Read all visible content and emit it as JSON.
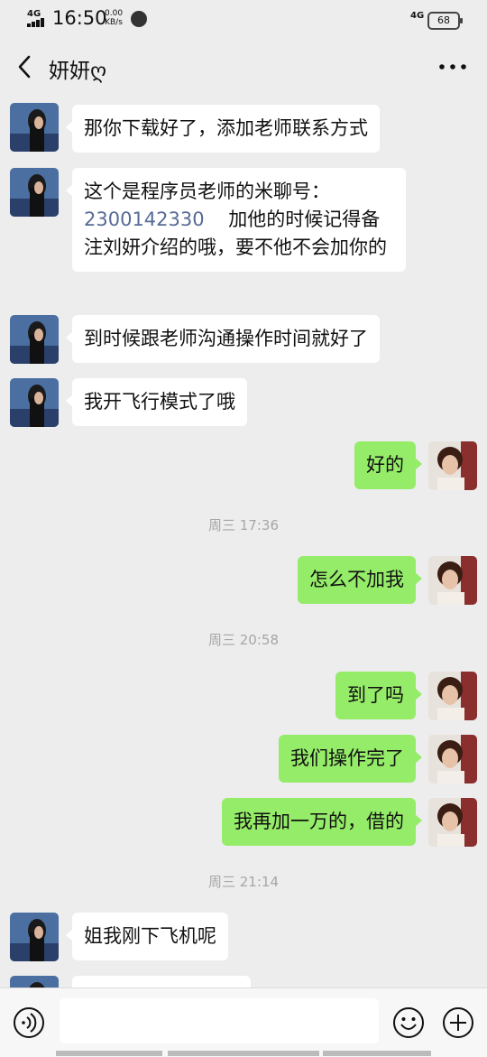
{
  "status_bar": {
    "time": "16:50",
    "network": "4G",
    "speed_top": "0.00",
    "speed_bottom": "KB/s",
    "network2": "4G",
    "battery": "68"
  },
  "header": {
    "title": "妍妍ღ",
    "back_icon": "chevron-left-icon",
    "more_icon": "more-dots-icon"
  },
  "messages": [
    {
      "side": "in",
      "text": "那你下载好了，添加老师联系方式"
    },
    {
      "side": "in",
      "parts": [
        "这个是程序员老师的米聊号：\n",
        "2300142330",
        "    加他的时候记得备注刘妍介绍的哦，要不他不会加你的"
      ]
    },
    {
      "side": "in",
      "text": "到时候跟老师沟通操作时间就好了"
    },
    {
      "side": "in",
      "text": "我开飞行模式了哦"
    },
    {
      "side": "out",
      "text": "好的"
    },
    {
      "timestamp": "周三 17:36"
    },
    {
      "side": "out",
      "text": "怎么不加我"
    },
    {
      "timestamp": "周三 20:58"
    },
    {
      "side": "out",
      "text": "到了吗"
    },
    {
      "side": "out",
      "text": "我们操作完了"
    },
    {
      "side": "out",
      "text": "我再加一万的，借的"
    },
    {
      "timestamp": "周三 21:14"
    },
    {
      "side": "in",
      "text": "姐我刚下飞机呢"
    }
  ],
  "input_bar": {
    "voice_icon": "voice-icon",
    "emoji_icon": "emoji-icon",
    "plus_icon": "plus-icon"
  },
  "colors": {
    "outgoing_bubble": "#95ec69",
    "incoming_bubble": "#ffffff",
    "link": "#576b95",
    "background": "#ededed"
  }
}
